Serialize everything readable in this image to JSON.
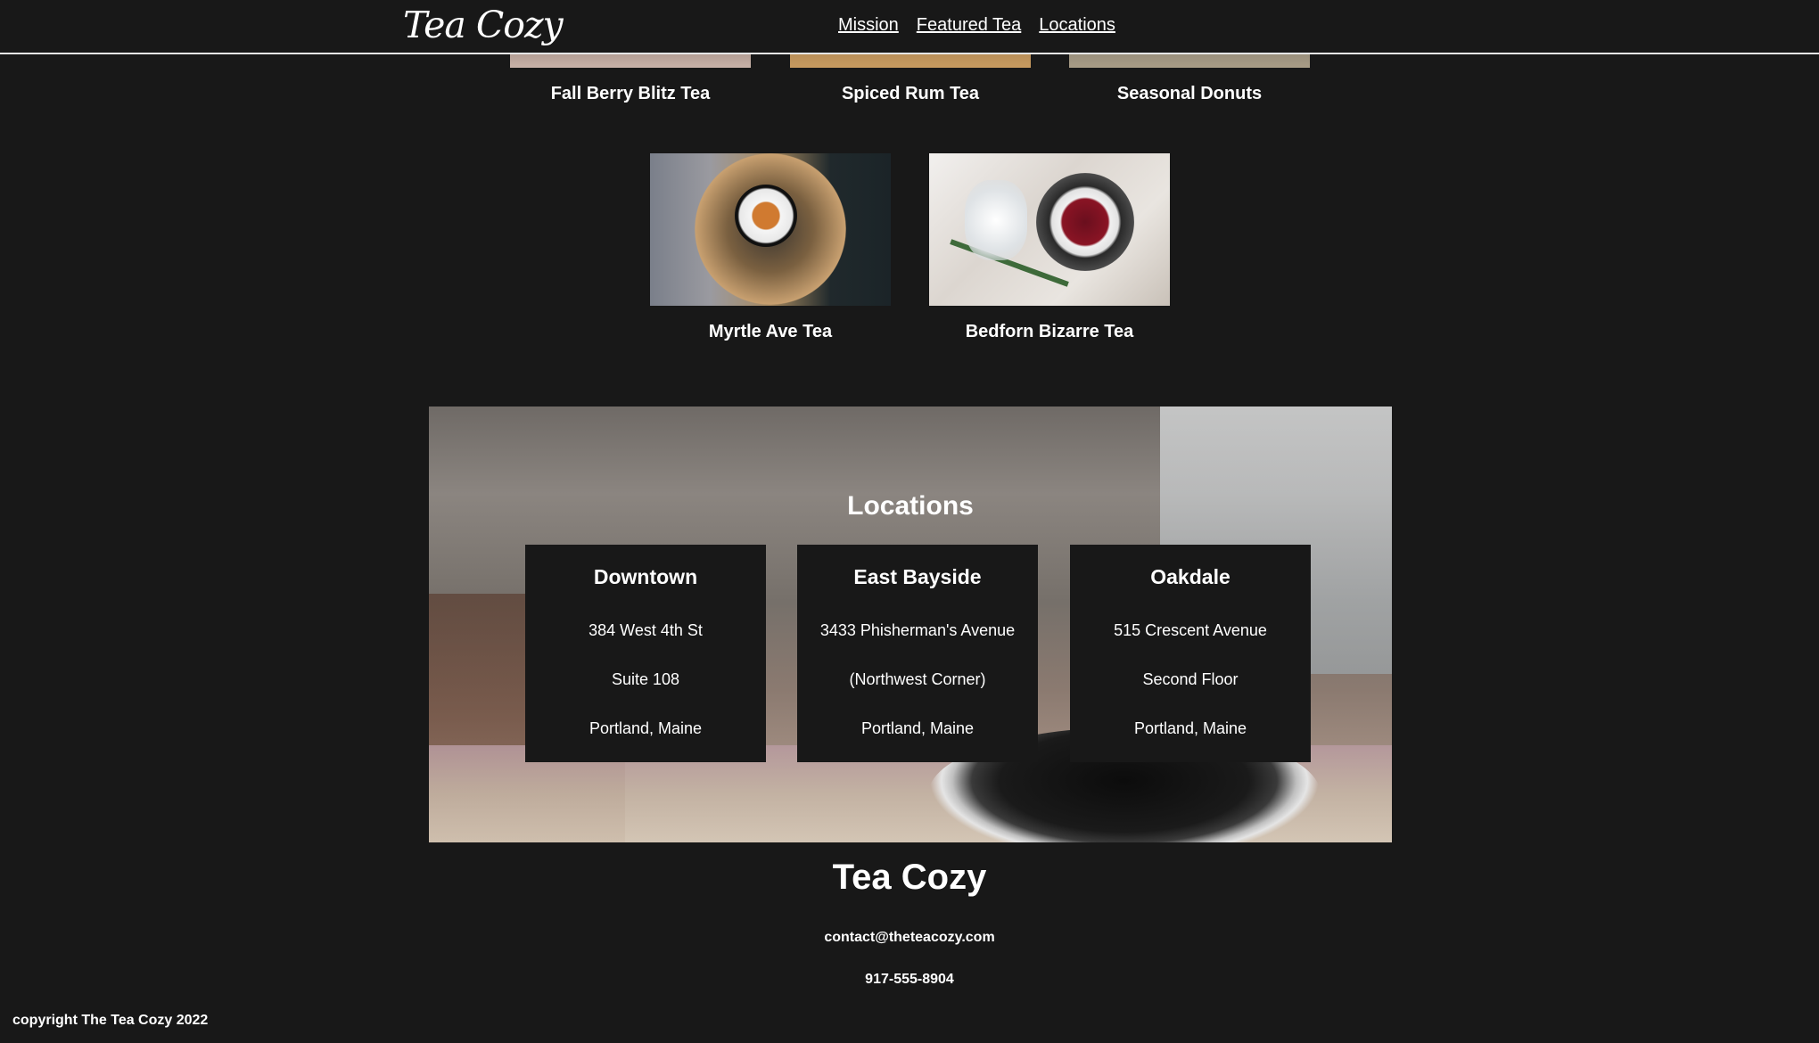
{
  "header": {
    "logo": "Tea Cozy",
    "nav": [
      "Mission",
      "Featured Tea",
      "Locations"
    ]
  },
  "teas": [
    {
      "name": "Fall Berry Blitz Tea",
      "image_icon": "tea-photo-icon"
    },
    {
      "name": "Spiced Rum Tea",
      "image_icon": "tea-photo-icon"
    },
    {
      "name": "Seasonal Donuts",
      "image_icon": "donut-photo-icon"
    },
    {
      "name": "Myrtle Ave Tea",
      "image_icon": "tea-photo-icon"
    },
    {
      "name": "Bedforn Bizarre Tea",
      "image_icon": "tea-photo-icon"
    }
  ],
  "locations": {
    "title": "Locations",
    "items": [
      {
        "name": "Downtown",
        "lines": [
          "384 West 4th St",
          "Suite 108",
          "Portland, Maine"
        ]
      },
      {
        "name": "East Bayside",
        "lines": [
          "3433 Phisherman's Avenue",
          "(Northwest Corner)",
          "Portland, Maine"
        ]
      },
      {
        "name": "Oakdale",
        "lines": [
          "515 Crescent Avenue",
          "Second Floor",
          "Portland, Maine"
        ]
      }
    ]
  },
  "footer": {
    "title": "Tea Cozy",
    "email": "contact@theteacozy.com",
    "phone": "917-555-8904",
    "copyright": "copyright The Tea Cozy 2022"
  },
  "colors": {
    "background": "#181818",
    "text": "#ffffff",
    "card": "#181818"
  }
}
